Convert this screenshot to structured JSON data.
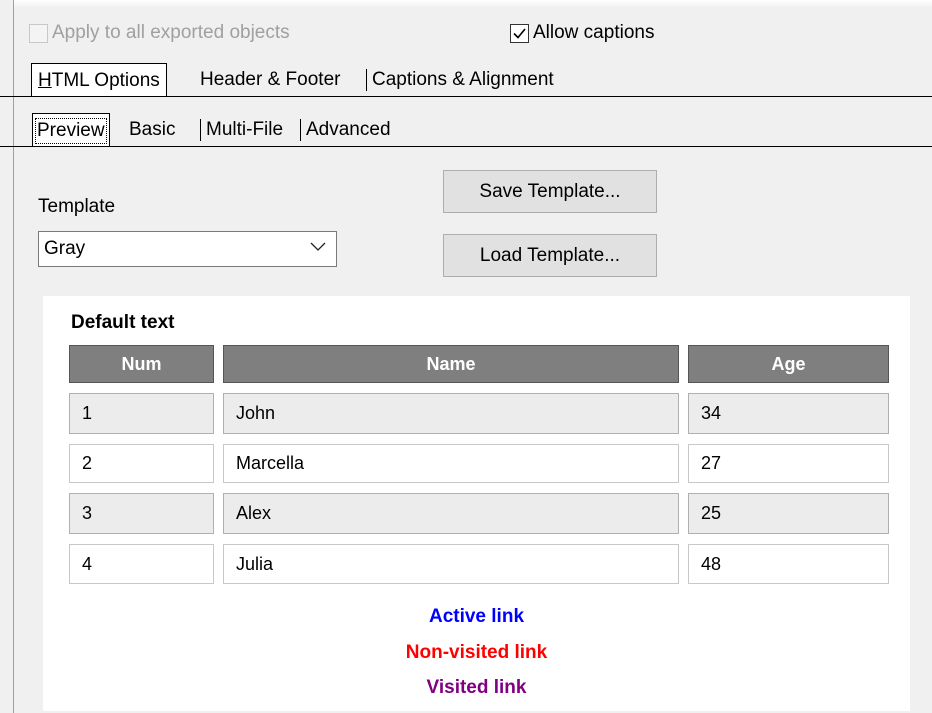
{
  "top": {
    "apply_all_label": "Apply to all exported objects",
    "apply_all_checked": false,
    "allow_captions_label": "Allow captions",
    "allow_captions_checked": true
  },
  "main_tabs": [
    {
      "label_u": "H",
      "label_rest": "TML Options",
      "active": true
    },
    {
      "label": "Header & Footer",
      "active": false
    },
    {
      "label": "Captions & Alignment",
      "active": false
    }
  ],
  "sub_tabs": [
    {
      "label": "Preview",
      "active": true
    },
    {
      "label": "Basic",
      "active": false
    },
    {
      "label": "Multi-File",
      "active": false
    },
    {
      "label": "Advanced",
      "active": false
    }
  ],
  "template": {
    "label": "Template",
    "selected": "Gray",
    "save_button": "Save Template...",
    "load_button": "Load Template..."
  },
  "preview": {
    "default_text": "Default text",
    "columns": [
      "Num",
      "Name",
      "Age"
    ],
    "rows": [
      [
        "1",
        "John",
        "34"
      ],
      [
        "2",
        "Marcella",
        "27"
      ],
      [
        "3",
        "Alex",
        "25"
      ],
      [
        "4",
        "Julia",
        "48"
      ]
    ],
    "active_link": "Active link",
    "nonvisited_link": "Non-visited link",
    "visited_link": "Visited link",
    "colors": {
      "active_link": "#0000ff",
      "nonvisited_link": "#ff0000",
      "visited_link": "#800080",
      "header_bg": "#7f7f7f",
      "row_alt_bg": "#ececec"
    }
  }
}
